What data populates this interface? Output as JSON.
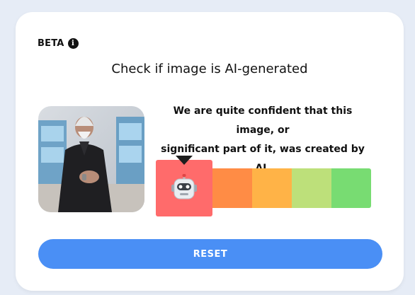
{
  "header": {
    "beta_label": "BETA",
    "title": "Check if image is AI-generated"
  },
  "result": {
    "confidence_text_line1": "We are quite confident that this image, or",
    "confidence_text_line2": "significant part of it, was created by AI.",
    "selected_level": "ai",
    "scale_colors": [
      "#ff6b6b",
      "#ff8c45",
      "#ffb347",
      "#bde07a",
      "#78dc72"
    ]
  },
  "actions": {
    "reset_label": "RESET"
  },
  "colors": {
    "accent": "#4a8ff5",
    "card_bg": "#ffffff",
    "page_bg": "#e6ecf6"
  }
}
